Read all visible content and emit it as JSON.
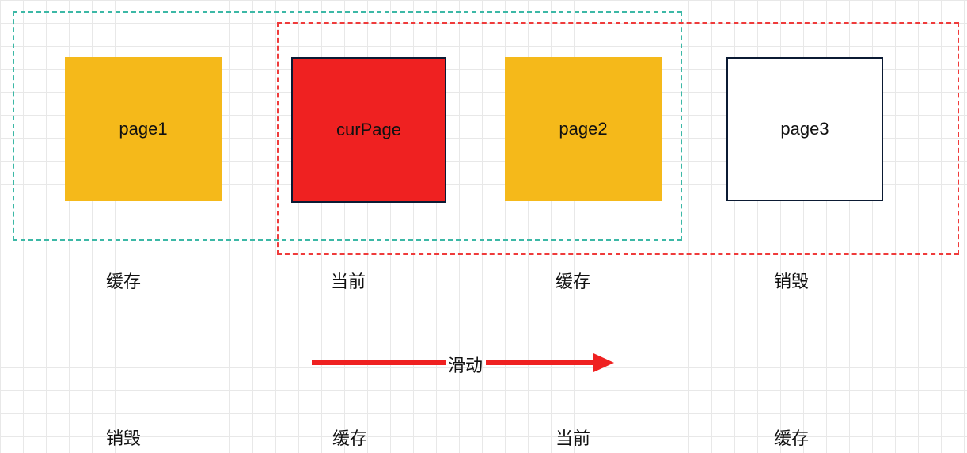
{
  "pages": {
    "p1": {
      "label": "page1"
    },
    "cur": {
      "label": "curPage"
    },
    "p2": {
      "label": "page2"
    },
    "p3": {
      "label": "page3"
    }
  },
  "row_top": {
    "c1": "缓存",
    "c2": "当前",
    "c3": "缓存",
    "c4": "销毁"
  },
  "arrow": {
    "label": "滑动"
  },
  "row_bottom": {
    "c1": "销毁",
    "c2": "缓存",
    "c3": "当前",
    "c4": "缓存"
  },
  "colors": {
    "teal": "#3cb8a6",
    "red_dash": "#ef3b3b",
    "page_yellow": "#f5b91a",
    "page_red": "#ef2121",
    "page_border_dark": "#0b1a33",
    "arrow": "#ef2121"
  }
}
